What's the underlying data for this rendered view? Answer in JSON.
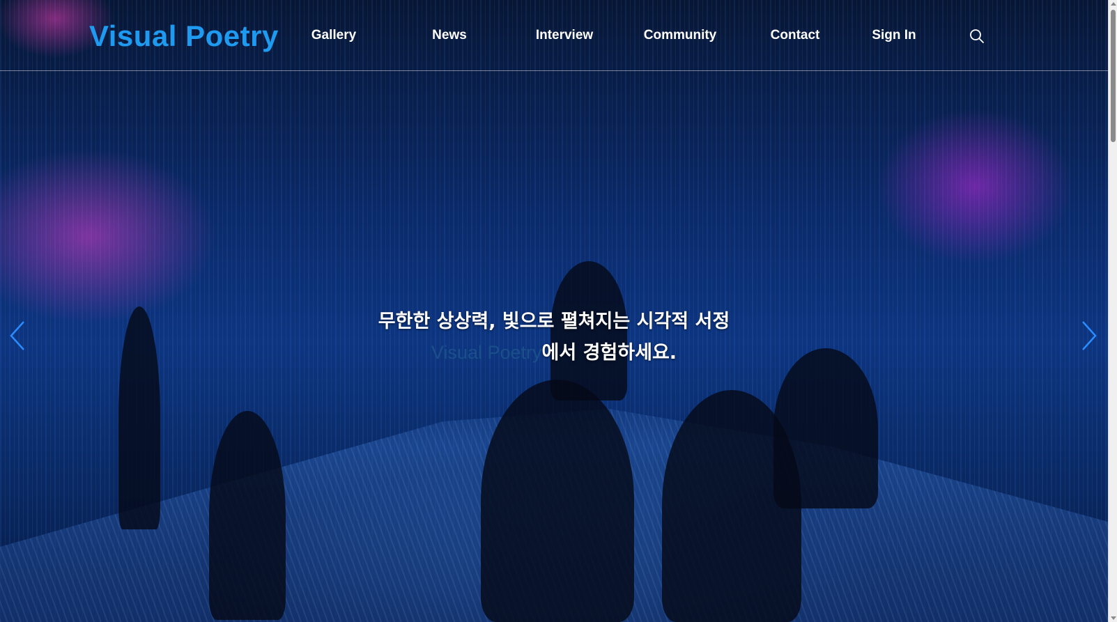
{
  "header": {
    "logo": "Visual Poetry",
    "nav": [
      {
        "label": "Gallery"
      },
      {
        "label": "News"
      },
      {
        "label": "Interview"
      },
      {
        "label": "Community"
      },
      {
        "label": "Contact"
      },
      {
        "label": "Sign In"
      }
    ],
    "search_icon": "search-icon"
  },
  "hero": {
    "line1": "무한한 상상력, 빛으로 펼쳐지는 시각적 서정",
    "line2_brand": "Visual Poetry",
    "line2_rest": "에서 경험하세요."
  },
  "slider": {
    "prev_icon": "chevron-left-icon",
    "next_icon": "chevron-right-icon"
  },
  "colors": {
    "accent": "#1e9bf0",
    "brand_in_headline": "#1b4f8a",
    "nav_text": "#ffffff"
  }
}
